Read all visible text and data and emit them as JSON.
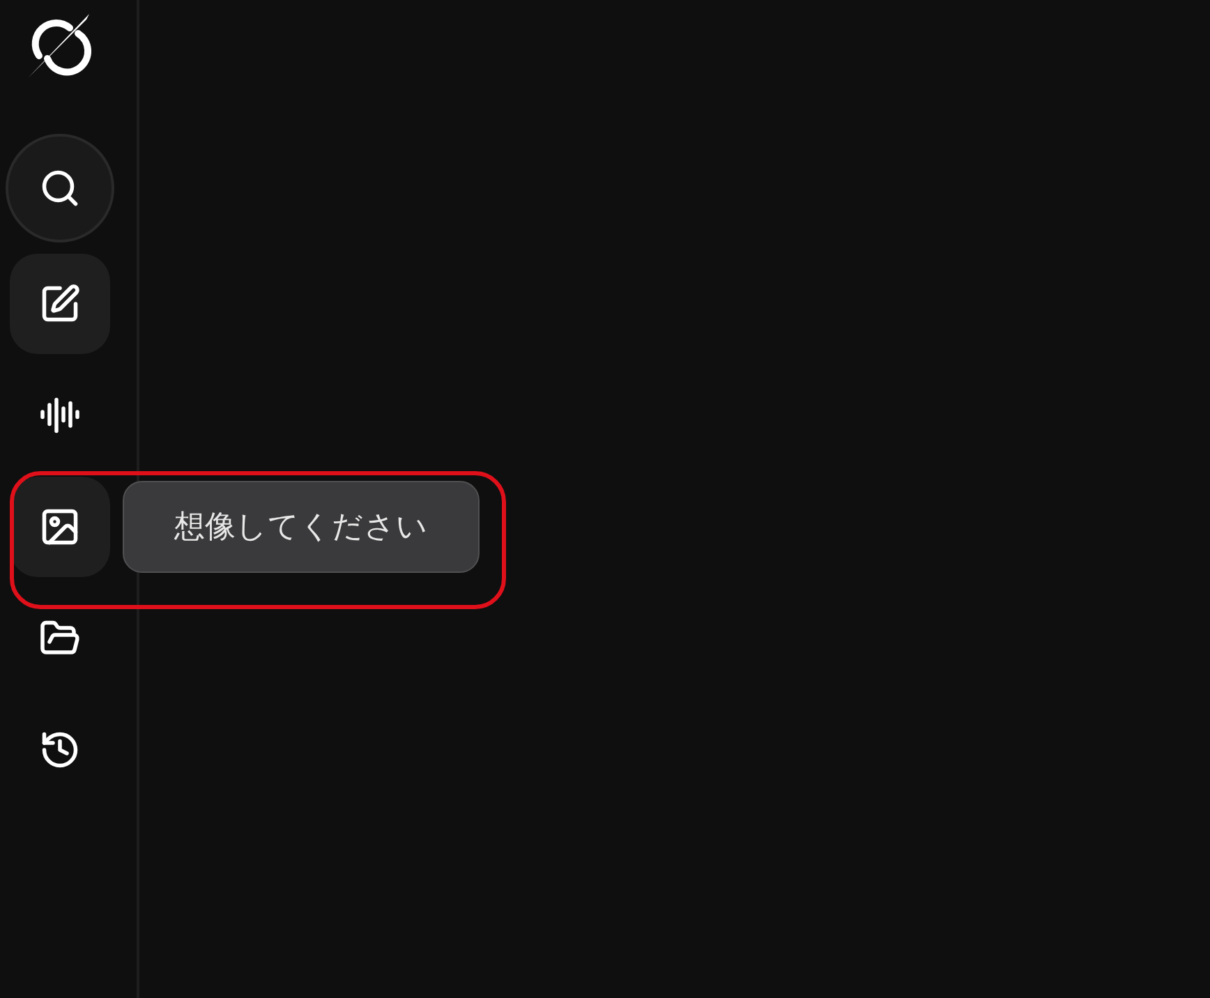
{
  "sidebar": {
    "items": [
      {
        "kind": "search"
      },
      {
        "kind": "edit",
        "highlighted": true
      },
      {
        "kind": "voice",
        "highlighted": false
      },
      {
        "kind": "image",
        "highlighted": true
      },
      {
        "kind": "folder",
        "highlighted": false
      },
      {
        "kind": "history",
        "highlighted": false
      }
    ]
  },
  "tooltip": {
    "text": "想像してください"
  }
}
